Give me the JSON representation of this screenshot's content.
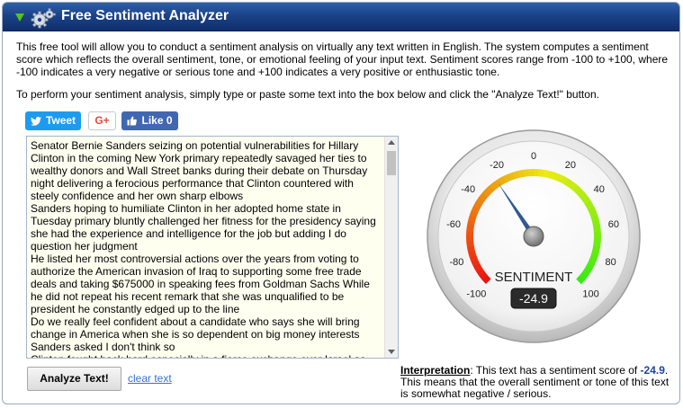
{
  "header": {
    "title": "Free Sentiment Analyzer",
    "accent_color": "#1b4389"
  },
  "intro": {
    "paragraph1": "This free tool will allow you to conduct a sentiment analysis on virtually any text written in English. The system computes a sentiment score which reflects the overall sentiment, tone, or emotional feeling of your input text. Sentiment scores range from -100 to +100, where -100 indicates a very negative or serious tone and +100 indicates a very positive or enthusiastic tone.",
    "paragraph2": "To perform your sentiment analysis, simply type or paste some text into the box below and click the \"Analyze Text!\" button."
  },
  "social": {
    "tweet_label": "Tweet",
    "gplus_label": "G+",
    "like_label": "Like 0"
  },
  "input": {
    "text": "Senator Bernie Sanders seizing on potential vulnerabilities for Hillary Clinton in the coming New York primary repeatedly savaged her ties to wealthy donors and Wall Street banks during their debate on Thursday night delivering a ferocious performance that Clinton countered with steely confidence and her own sharp elbows\nSanders hoping to humiliate Clinton in her adopted home state in Tuesday primary bluntly challenged her fitness for the presidency saying she had the experience and intelligence for the job but adding I do question her judgment\nHe listed her most controversial actions over the years from voting to authorize the American invasion of Iraq to supporting some free trade deals and taking $675000 in speaking fees from Goldman Sachs While he did not repeat his recent remark that she was unqualified to be president he constantly edged up to the line\nDo we really feel confident about a candidate who says she will bring change in America when she is so dependent on big money interests Sanders asked I don't think so\nClinton fought back hard especially in a fierce exchange over Israel as"
  },
  "actions": {
    "analyze_label": "Analyze Text!",
    "clear_label": "clear text"
  },
  "gauge": {
    "score": -24.9,
    "score_text": "-24.9",
    "label": "SENTIMENT",
    "min": -100,
    "max": 100,
    "tick_labels": [
      "-100",
      "-80",
      "-60",
      "-40",
      "-20",
      "0",
      "20",
      "40",
      "60",
      "80",
      "100"
    ]
  },
  "interpretation": {
    "label": "Interpretation",
    "prefix": ": This text has a sentiment score of ",
    "score": "-24.9",
    "suffix": ". This means that the overall sentiment or tone of this text is somewhat negative / serious."
  }
}
